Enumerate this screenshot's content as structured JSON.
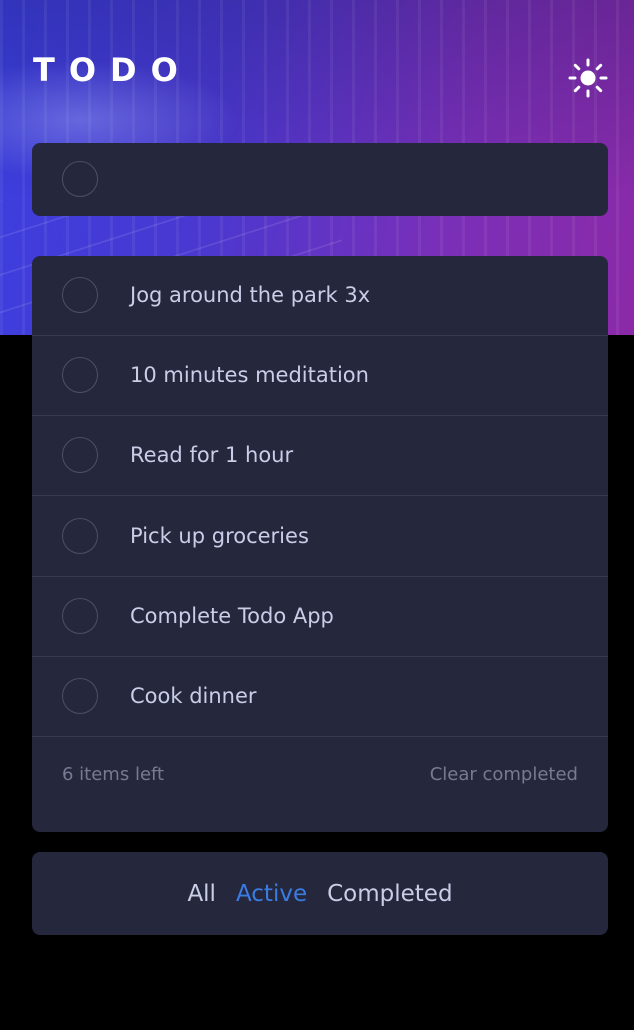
{
  "app": {
    "title": "TODO"
  },
  "icons": {
    "theme_toggle": "sun-icon"
  },
  "new_todo": {
    "value": "",
    "placeholder": ""
  },
  "todos": [
    {
      "label": "Jog around the park 3x",
      "completed": false
    },
    {
      "label": "10 minutes meditation",
      "completed": false
    },
    {
      "label": "Read for 1 hour",
      "completed": false
    },
    {
      "label": "Pick up groceries",
      "completed": false
    },
    {
      "label": "Complete Todo App",
      "completed": false
    },
    {
      "label": "Cook dinner",
      "completed": false
    }
  ],
  "footer": {
    "items_left": "6 items left",
    "clear_label": "Clear completed"
  },
  "filters": {
    "all": "All",
    "active": "Active",
    "completed": "Completed",
    "selected": "active"
  },
  "colors": {
    "accent": "#3a7ce2",
    "card_bg": "#25273c",
    "text": "#cacde8",
    "muted": "#777a92",
    "divider": "#393a4c",
    "gradient_start": "#3b3fe0",
    "gradient_end": "#8b2aa8"
  }
}
